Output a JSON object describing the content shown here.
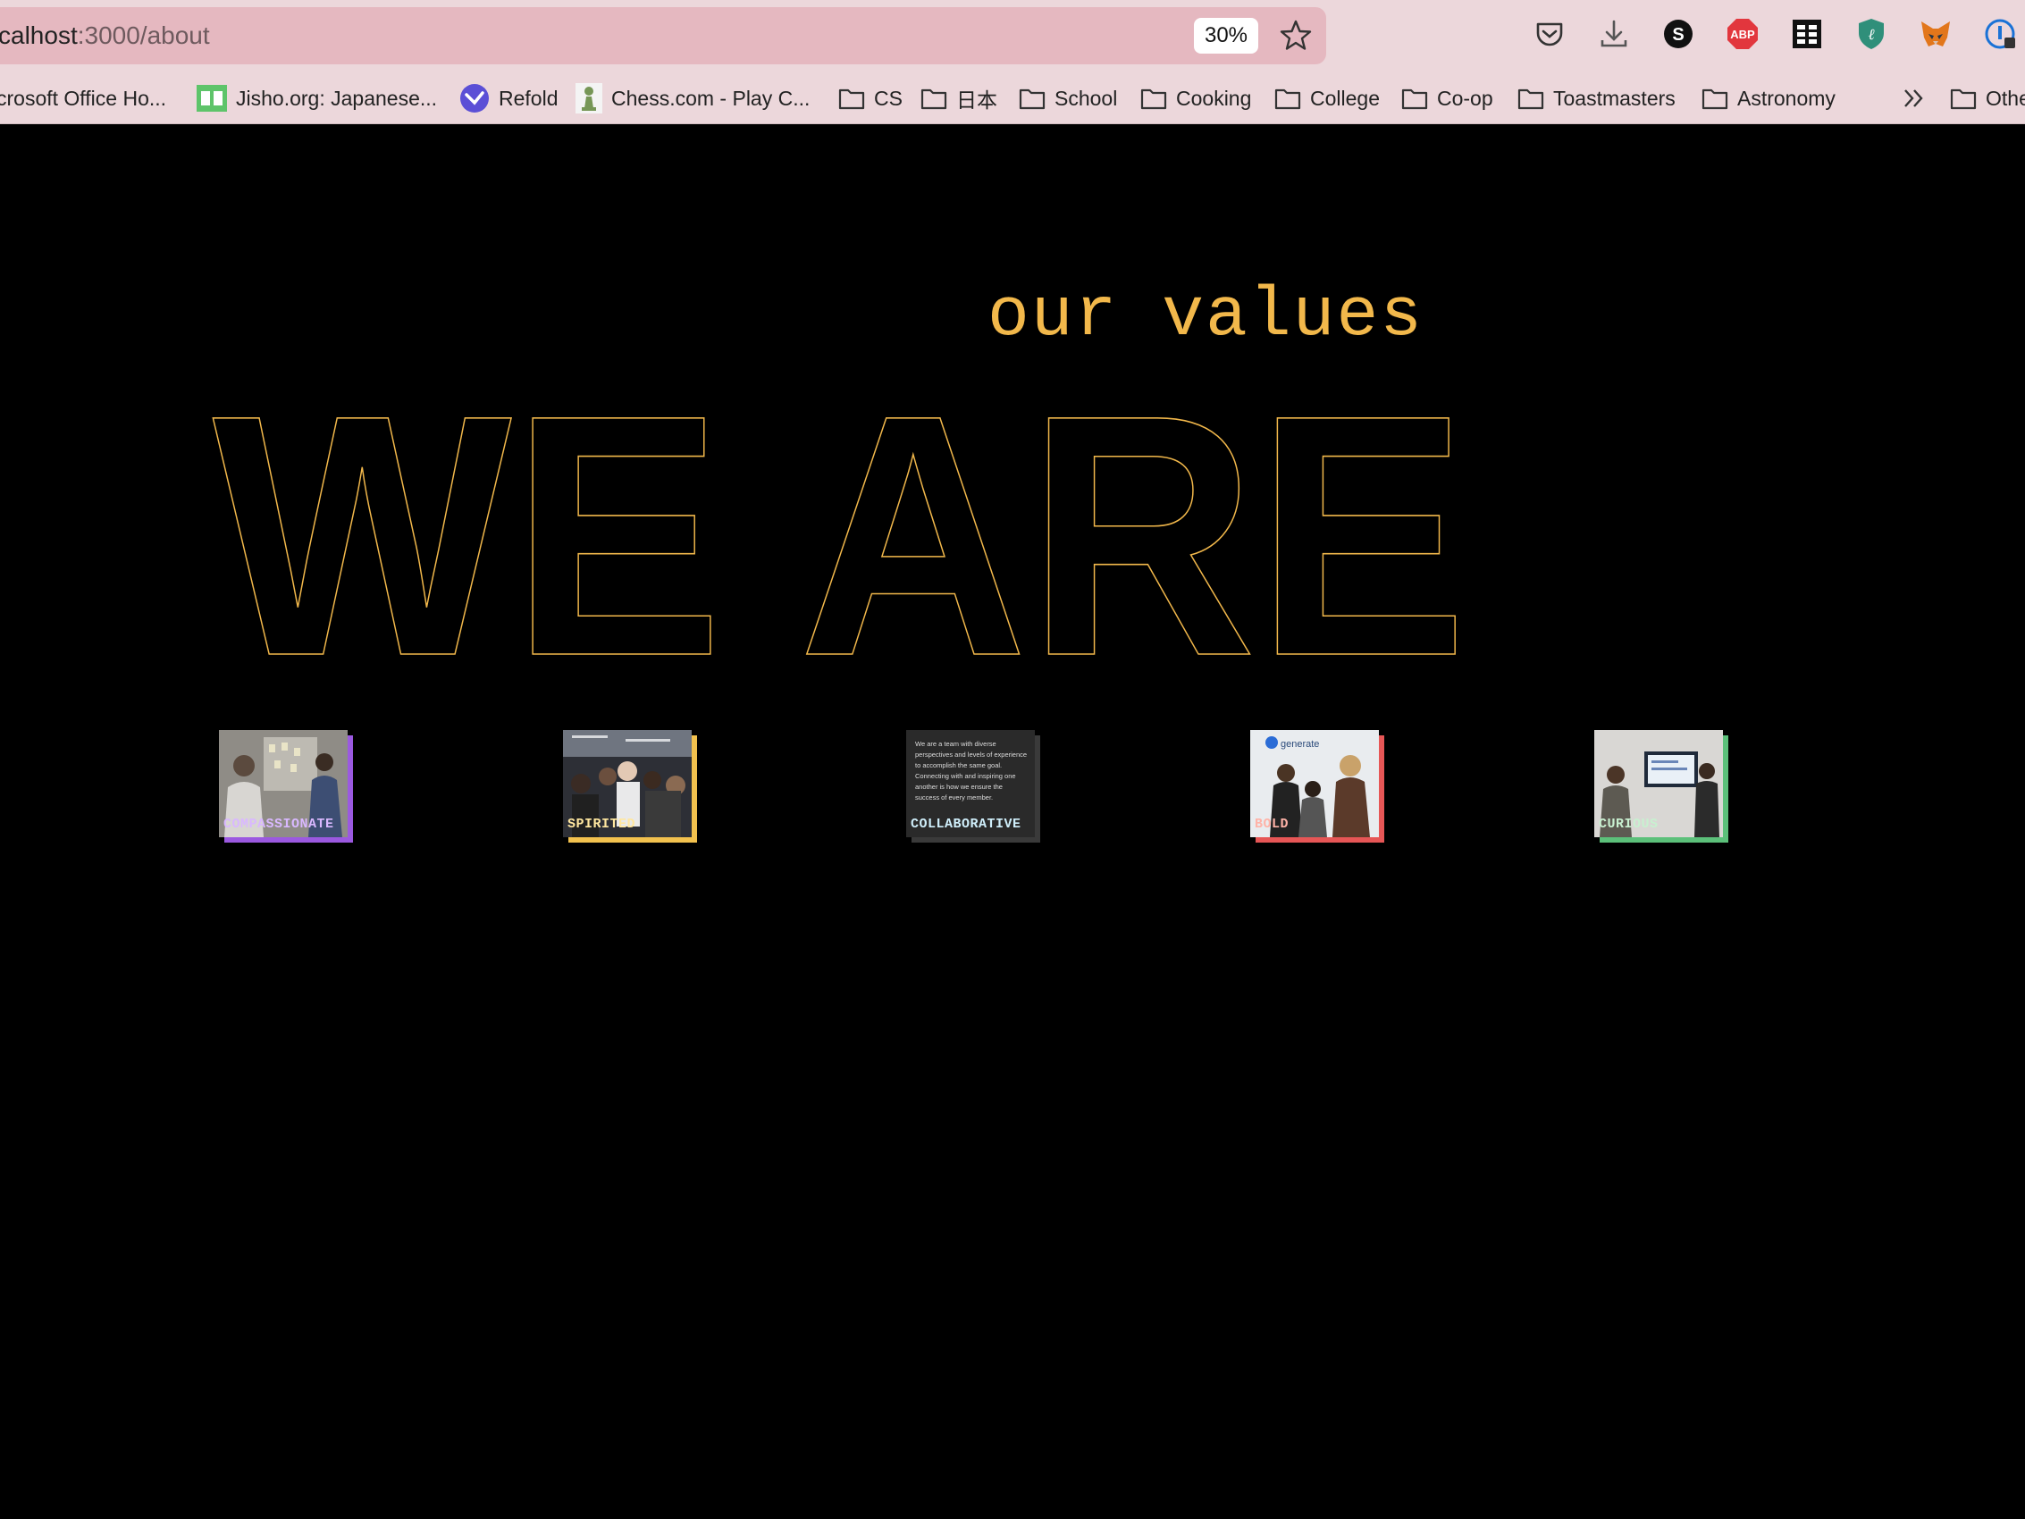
{
  "browser": {
    "url_host": "calhost",
    "url_path": ":3000/about",
    "zoom_level": "30%",
    "toolbar_icons": [
      "pocket-icon",
      "download-icon",
      "s-extension-icon",
      "adblock-plus-icon",
      "table-extension-icon",
      "shield-extension-icon",
      "metamask-fox-icon",
      "onepassword-icon"
    ],
    "adblock_label": "ABP",
    "s_label": "S",
    "bookmarks": [
      {
        "label": "crosoft Office Ho...",
        "icon": "none"
      },
      {
        "label": "Jisho.org: Japanese...",
        "icon": "jisho-icon"
      },
      {
        "label": "Refold",
        "icon": "refold-icon"
      },
      {
        "label": "Chess.com - Play C...",
        "icon": "chess-pawn-icon"
      },
      {
        "label": "CS",
        "icon": "folder-icon"
      },
      {
        "label": "日本",
        "icon": "folder-icon"
      },
      {
        "label": "School",
        "icon": "folder-icon"
      },
      {
        "label": "Cooking",
        "icon": "folder-icon"
      },
      {
        "label": "College",
        "icon": "folder-icon"
      },
      {
        "label": "Co-op",
        "icon": "folder-icon"
      },
      {
        "label": "Toastmasters",
        "icon": "folder-icon"
      },
      {
        "label": "Astronomy",
        "icon": "folder-icon"
      },
      {
        "label": "Othe",
        "icon": "folder-icon"
      }
    ]
  },
  "page": {
    "values_heading": "our values",
    "big_title": "WE ARE",
    "accent_color": "#f2b84b",
    "cards": [
      {
        "label": "COMPASSIONATE",
        "accent": "#9b59e0",
        "label_color": "#d9b8ff"
      },
      {
        "label": "SPIRITED",
        "accent": "#f2c14e",
        "label_color": "#ffe7a0"
      },
      {
        "label": "COLLABORATIVE",
        "accent": "#3a3a3a",
        "label_color": "#cfeefa"
      },
      {
        "label": "BOLD",
        "accent": "#e65656",
        "label_color": "#ffb3a8"
      },
      {
        "label": "CURIOUS",
        "accent": "#5cc07a",
        "label_color": "#c8f0d0"
      }
    ],
    "collaborative_text": "We are a team with diverse perspectives and levels of experience to accomplish the same goal. Connecting with and inspiring one another is how we ensure the success of every member.",
    "bold_logo_text": "generate"
  }
}
